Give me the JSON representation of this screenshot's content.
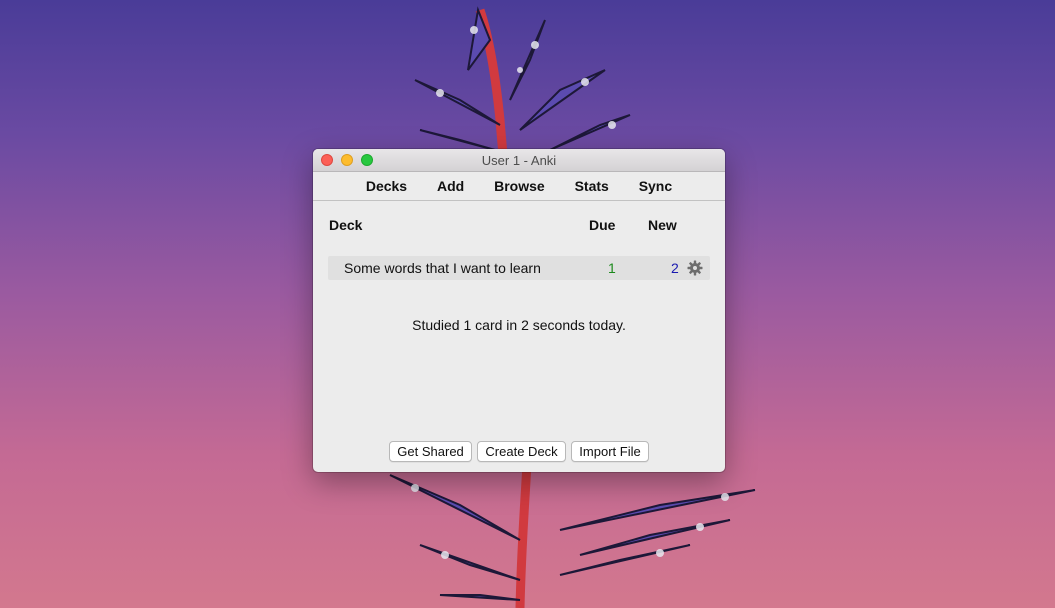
{
  "window": {
    "title": "User 1 - Anki"
  },
  "toolbar": {
    "items": [
      "Decks",
      "Add",
      "Browse",
      "Stats",
      "Sync"
    ]
  },
  "deck_table": {
    "headers": {
      "deck": "Deck",
      "due": "Due",
      "new": "New"
    },
    "rows": [
      {
        "name": "Some words that I want to learn",
        "due": "1",
        "new": "2",
        "options_icon": "gear-icon"
      }
    ]
  },
  "study_stats": "Studied 1 card in 2 seconds today.",
  "footer_buttons": {
    "get_shared": "Get Shared",
    "create_deck": "Create Deck",
    "import_file": "Import File"
  },
  "colors": {
    "due_count": "#1c8a1c",
    "new_count": "#1a1ab0",
    "traffic_close": "#fc5f57",
    "traffic_minimize": "#fdbc2e",
    "traffic_maximize": "#28c840"
  }
}
